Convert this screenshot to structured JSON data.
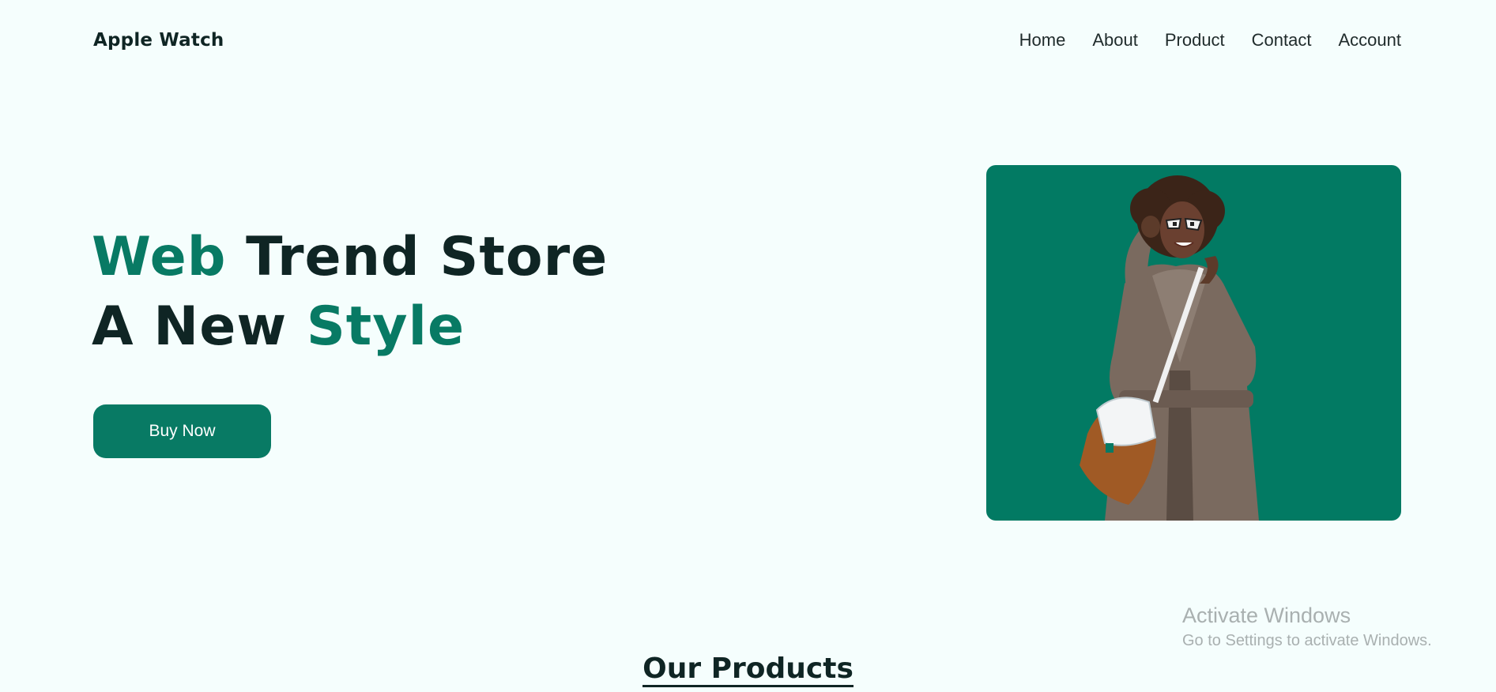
{
  "header": {
    "brand": "Apple Watch",
    "nav": {
      "home": "Home",
      "about": "About",
      "product": "Product",
      "contact": "Contact",
      "account": "Account"
    }
  },
  "hero": {
    "title_line1_accent": "Web",
    "title_line1_rest": " Trend Store",
    "title_line2_start": "A New ",
    "title_line2_accent": "Style",
    "button_label": "Buy Now",
    "image_subject": "woman-fashion-photo"
  },
  "products": {
    "heading": "Our Products"
  },
  "watermark": {
    "title": "Activate Windows",
    "subtitle": "Go to Settings to activate Windows."
  },
  "colors": {
    "background": "#f5fefd",
    "accent": "#087a64",
    "dark_text": "#0f2524",
    "image_bg": "#027a63"
  }
}
